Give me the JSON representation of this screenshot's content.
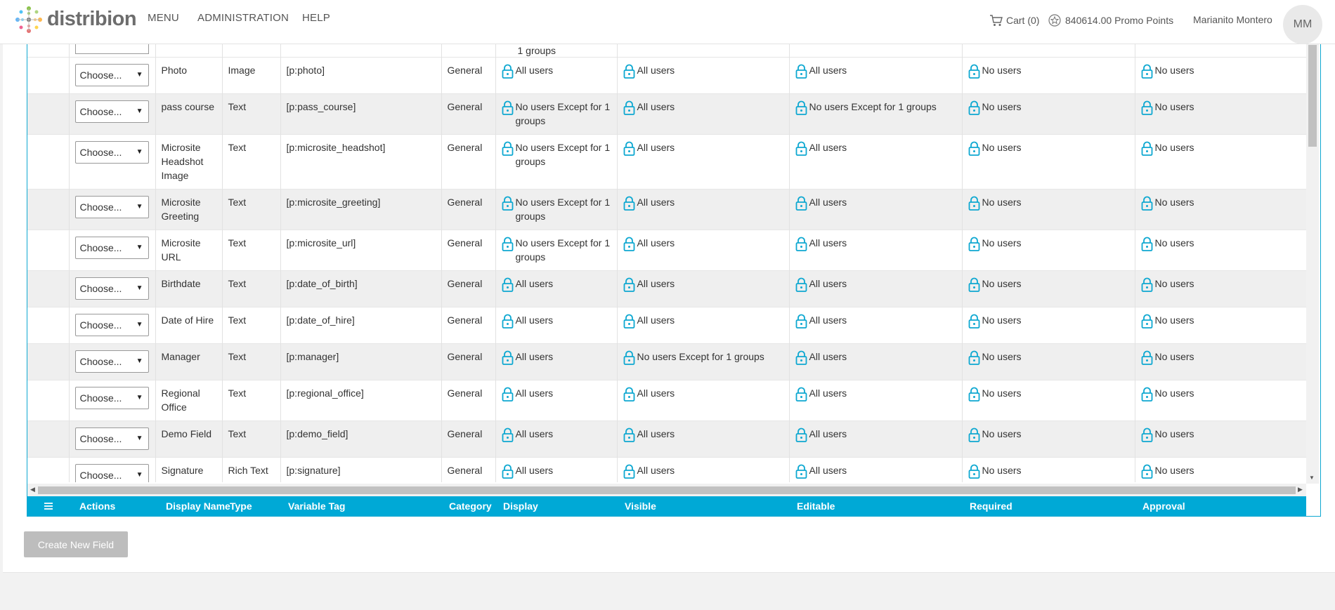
{
  "brand": {
    "name": "distribion"
  },
  "nav": {
    "menu": "MENU",
    "administration": "ADMINISTRATION",
    "help": "HELP"
  },
  "user": {
    "cart_label": "Cart (0)",
    "promo_points": "840614.00 Promo Points",
    "name": "Marianito Montero",
    "initials": "MM"
  },
  "colors": {
    "accent": "#00a9d6",
    "lock": "#0ea8d1",
    "button": "#bdbdbd"
  },
  "partial_row_text": "1 groups",
  "columns": [
    "Actions",
    "Display Name",
    "Type",
    "Variable Tag",
    "Category",
    "Display",
    "Visible",
    "Editable",
    "Required",
    "Approval"
  ],
  "select_placeholder": "Choose...",
  "rows": [
    {
      "name": "Photo",
      "type": "Image",
      "tag": "[p:photo]",
      "category": "General",
      "display": "All users",
      "visible": "All users",
      "editable": "All users",
      "required": "No users",
      "approval": "No users"
    },
    {
      "name": "pass course",
      "type": "Text",
      "tag": "[p:pass_course]",
      "category": "General",
      "display": "No users Except for 1 groups",
      "visible": "All users",
      "editable": "No users Except for 1 groups",
      "required": "No users",
      "approval": "No users"
    },
    {
      "name": "Microsite Headshot Image",
      "type": "Text",
      "tag": "[p:microsite_headshot]",
      "category": "General",
      "display": "No users Except for 1 groups",
      "visible": "All users",
      "editable": "All users",
      "required": "No users",
      "approval": "No users"
    },
    {
      "name": "Microsite Greeting",
      "type": "Text",
      "tag": "[p:microsite_greeting]",
      "category": "General",
      "display": "No users Except for 1 groups",
      "visible": "All users",
      "editable": "All users",
      "required": "No users",
      "approval": "No users"
    },
    {
      "name": "Microsite URL",
      "type": "Text",
      "tag": "[p:microsite_url]",
      "category": "General",
      "display": "No users Except for 1 groups",
      "visible": "All users",
      "editable": "All users",
      "required": "No users",
      "approval": "No users"
    },
    {
      "name": "Birthdate",
      "type": "Text",
      "tag": "[p:date_of_birth]",
      "category": "General",
      "display": "All users",
      "visible": "All users",
      "editable": "All users",
      "required": "No users",
      "approval": "No users"
    },
    {
      "name": "Date of Hire",
      "type": "Text",
      "tag": "[p:date_of_hire]",
      "category": "General",
      "display": "All users",
      "visible": "All users",
      "editable": "All users",
      "required": "No users",
      "approval": "No users"
    },
    {
      "name": "Manager",
      "type": "Text",
      "tag": "[p:manager]",
      "category": "General",
      "display": "All users",
      "visible": "No users Except for 1 groups",
      "editable": "All users",
      "required": "No users",
      "approval": "No users"
    },
    {
      "name": "Regional Office",
      "type": "Text",
      "tag": "[p:regional_office]",
      "category": "General",
      "display": "All users",
      "visible": "All users",
      "editable": "All users",
      "required": "No users",
      "approval": "No users"
    },
    {
      "name": "Demo Field",
      "type": "Text",
      "tag": "[p:demo_field]",
      "category": "General",
      "display": "All users",
      "visible": "All users",
      "editable": "All users",
      "required": "No users",
      "approval": "No users"
    },
    {
      "name": "Signature",
      "type": "Rich Text",
      "tag": "[p:signature]",
      "category": "General",
      "display": "All users",
      "visible": "All users",
      "editable": "All users",
      "required": "No users",
      "approval": "No users"
    }
  ],
  "create_button": "Create New Field"
}
